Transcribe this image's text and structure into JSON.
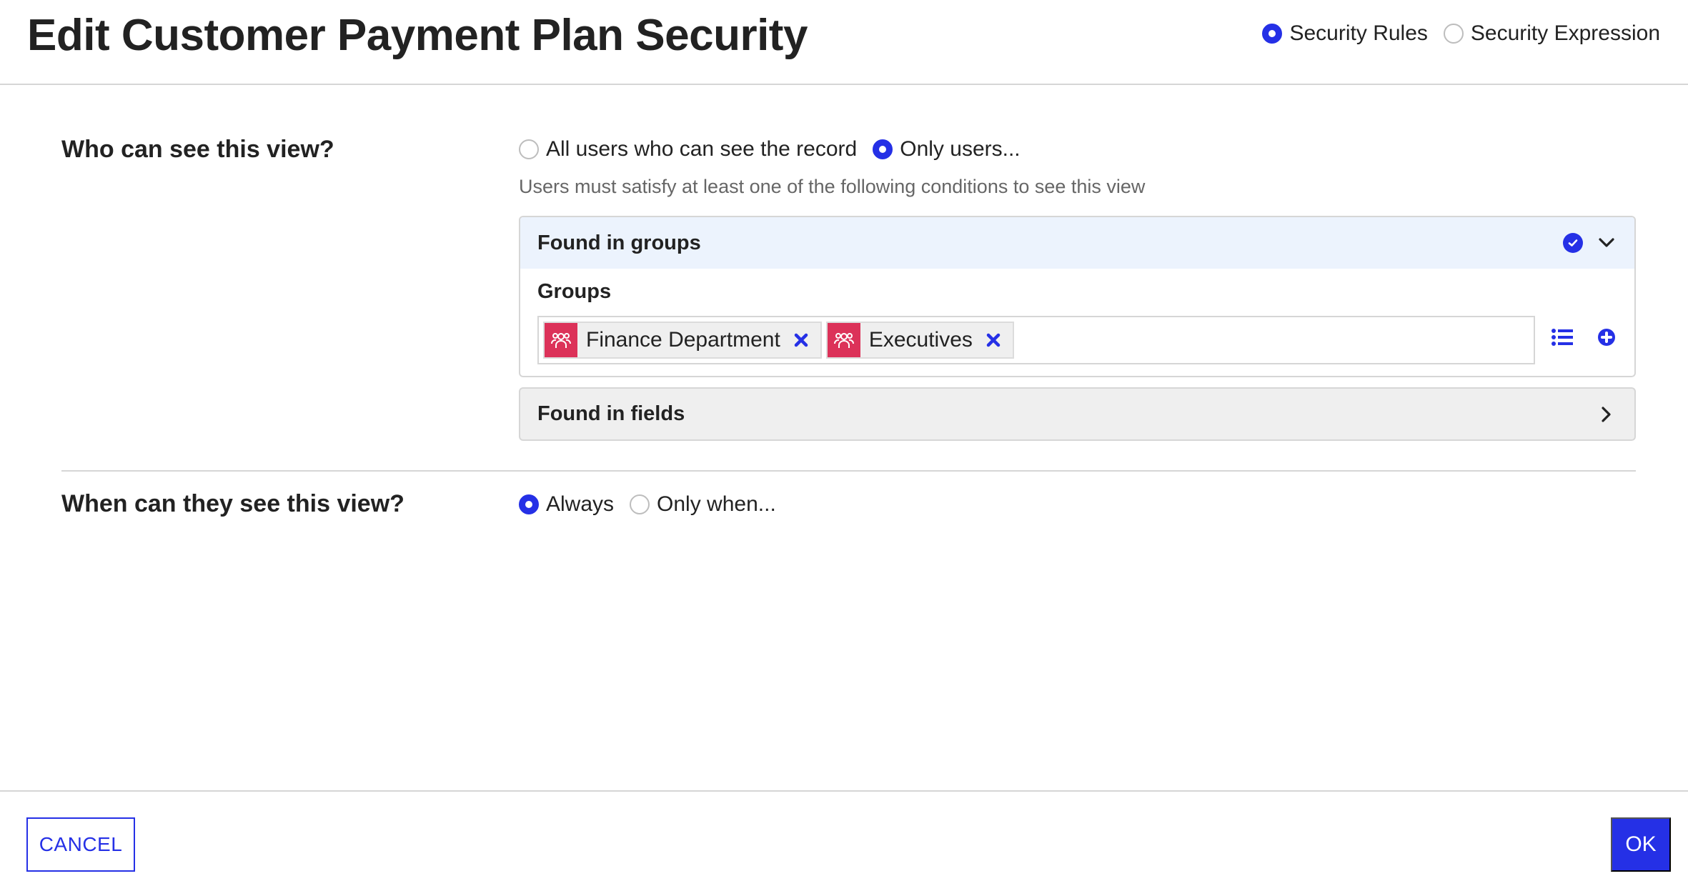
{
  "dialog": {
    "title": "Edit Customer Payment Plan Security",
    "mode_options": [
      {
        "label": "Security Rules",
        "selected": true
      },
      {
        "label": "Security Expression",
        "selected": false
      }
    ]
  },
  "who_section": {
    "label": "Who can see this view?",
    "options": [
      {
        "label": "All users who can see the record",
        "selected": false
      },
      {
        "label": "Only users...",
        "selected": true
      }
    ],
    "helper_text": "Users must satisfy at least one of the following conditions to see this view",
    "groups_panel": {
      "title": "Found in groups",
      "status_icon": "check-circle-icon",
      "expanded": true,
      "field_label": "Groups",
      "selected_groups": [
        {
          "label": "Finance Department",
          "icon": "group-icon"
        },
        {
          "label": "Executives",
          "icon": "group-icon"
        }
      ],
      "actions": [
        "list-icon",
        "add-circle-icon"
      ]
    },
    "fields_panel": {
      "title": "Found in fields",
      "expanded": false
    }
  },
  "when_section": {
    "label": "When can they see this view?",
    "options": [
      {
        "label": "Always",
        "selected": true
      },
      {
        "label": "Only when...",
        "selected": false
      }
    ]
  },
  "footer": {
    "cancel_label": "CANCEL",
    "ok_label": "OK"
  },
  "colors": {
    "accent": "#2530e6",
    "chip_icon_bg": "#dc3259",
    "panel_header_bg": "#ecf3fd",
    "collapsed_panel_bg": "#efefef"
  }
}
